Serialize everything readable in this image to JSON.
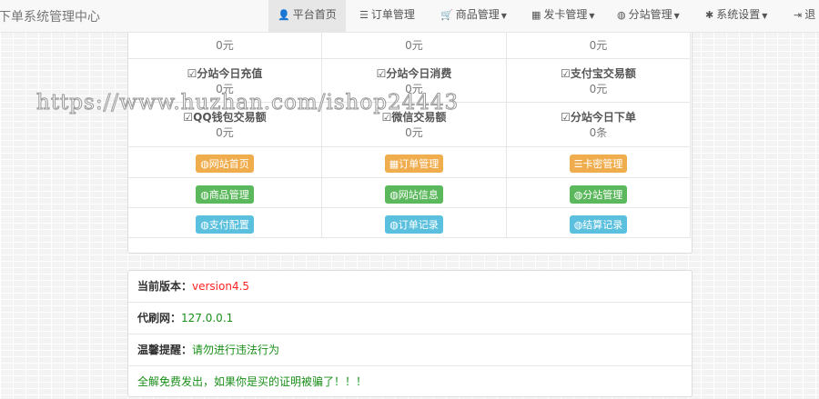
{
  "nav": {
    "brand": "下单系统管理中心",
    "items": [
      {
        "icon": "user-icon",
        "glyph": "👤",
        "label": "平台首页",
        "dropdown": false
      },
      {
        "icon": "list-icon",
        "glyph": "☰",
        "label": "订单管理",
        "dropdown": false
      },
      {
        "icon": "cart-icon",
        "glyph": "🛒",
        "label": "商品管理",
        "dropdown": true
      },
      {
        "icon": "grid-icon",
        "glyph": "▦",
        "label": "发卡管理",
        "dropdown": true
      },
      {
        "icon": "globe-icon",
        "glyph": "◍",
        "label": "分站管理",
        "dropdown": true
      },
      {
        "icon": "cog-icon",
        "glyph": "✱",
        "label": "系统设置",
        "dropdown": true
      },
      {
        "icon": "logout-icon",
        "glyph": "⇥",
        "label": "退",
        "dropdown": false
      }
    ]
  },
  "stats": [
    {
      "label": "",
      "value": "0元"
    },
    {
      "label": "",
      "value": "0元"
    },
    {
      "label": "",
      "value": "0元"
    },
    {
      "label": "分站今日充值",
      "value": "0元"
    },
    {
      "label": "分站今日消费",
      "value": "0元"
    },
    {
      "label": "支付宝交易额",
      "value": "0元"
    },
    {
      "label": "QQ钱包交易额",
      "value": "0元"
    },
    {
      "label": "微信交易额",
      "value": "0元"
    },
    {
      "label": "分站今日下单",
      "value": "0条"
    }
  ],
  "links": [
    {
      "label": "网站首页",
      "color": "orange",
      "icon": "globe-icon",
      "glyph": "◍"
    },
    {
      "label": "订单管理",
      "color": "orange",
      "icon": "calendar-icon",
      "glyph": "▦"
    },
    {
      "label": "卡密管理",
      "color": "orange",
      "icon": "list-icon",
      "glyph": "☰"
    },
    {
      "label": "商品管理",
      "color": "green",
      "icon": "globe-icon",
      "glyph": "◍"
    },
    {
      "label": "网站信息",
      "color": "green",
      "icon": "globe-icon",
      "glyph": "◍"
    },
    {
      "label": "分站管理",
      "color": "green",
      "icon": "globe-icon",
      "glyph": "◍"
    },
    {
      "label": "支付配置",
      "color": "blue",
      "icon": "globe-icon",
      "glyph": "◍"
    },
    {
      "label": "订单记录",
      "color": "blue",
      "icon": "globe-icon",
      "glyph": "◍"
    },
    {
      "label": "结算记录",
      "color": "blue",
      "icon": "globe-icon",
      "glyph": "◍"
    }
  ],
  "info": {
    "version_label": "当前版本：",
    "version_value": "version4.5",
    "version_color": "#ff2222",
    "site_label": "代刷网：",
    "site_value": "127.0.0.1",
    "tip_label": "温馨提醒：",
    "tip_value": "请勿进行违法行为",
    "notice": "全解免费发出，如果你是买的证明被骗了！！！",
    "green": "#1a8f1a"
  },
  "watermark": "https://www.huzhan.com/ishop24443"
}
